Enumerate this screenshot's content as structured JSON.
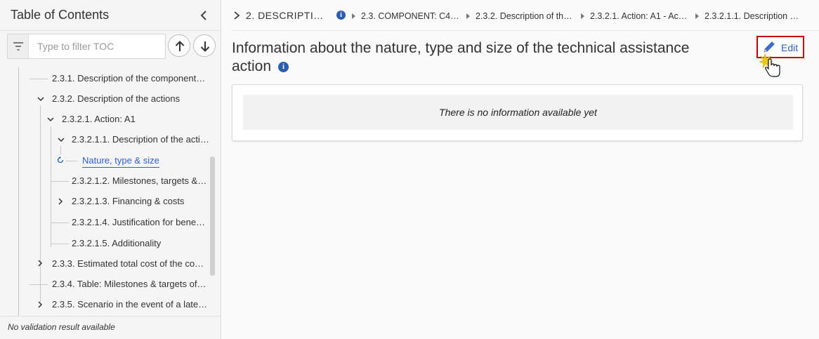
{
  "sidebar": {
    "title": "Table of Contents",
    "filter": {
      "placeholder": "Type to filter TOC",
      "value": ""
    },
    "tree": {
      "i231": "2.3.1. Description of the component…",
      "i232": "2.3.2. Description of the actions",
      "i2321": "2.3.2.1. Action: A1",
      "i23211": "2.3.2.1.1. Description of the acti…",
      "active": "Nature, type & size",
      "i23212": "2.3.2.1.2. Milestones, targets &…",
      "i23213": "2.3.2.1.3. Financing & costs",
      "i23214": "2.3.2.1.4. Justification for bene…",
      "i23215": "2.3.2.1.5. Additionality",
      "i233": "2.3.3. Estimated total cost of the co…",
      "i234": "2.3.4. Table: Milestones & targets of…",
      "i235": "2.3.5. Scenario in the event of a late…"
    },
    "status": "No validation result available"
  },
  "breadcrumb": {
    "c1": "2. DESCRIPTION…",
    "c2": "2.3. COMPONENT: C4…",
    "c3": "2.3.2. Description of th…",
    "c4": "2.3.2.1. Action: A1 - Ac…",
    "c5": "2.3.2.1.1. Description …"
  },
  "section": {
    "title": "Information about the nature, type and size of the technical assistance action",
    "info_icon_glyph": "i"
  },
  "edit": {
    "label": "Edit"
  },
  "content": {
    "empty_message": "There is no information available yet"
  },
  "colors": {
    "accent": "#2d61c4",
    "info": "#2a5db0",
    "highlight": "#c00000"
  }
}
